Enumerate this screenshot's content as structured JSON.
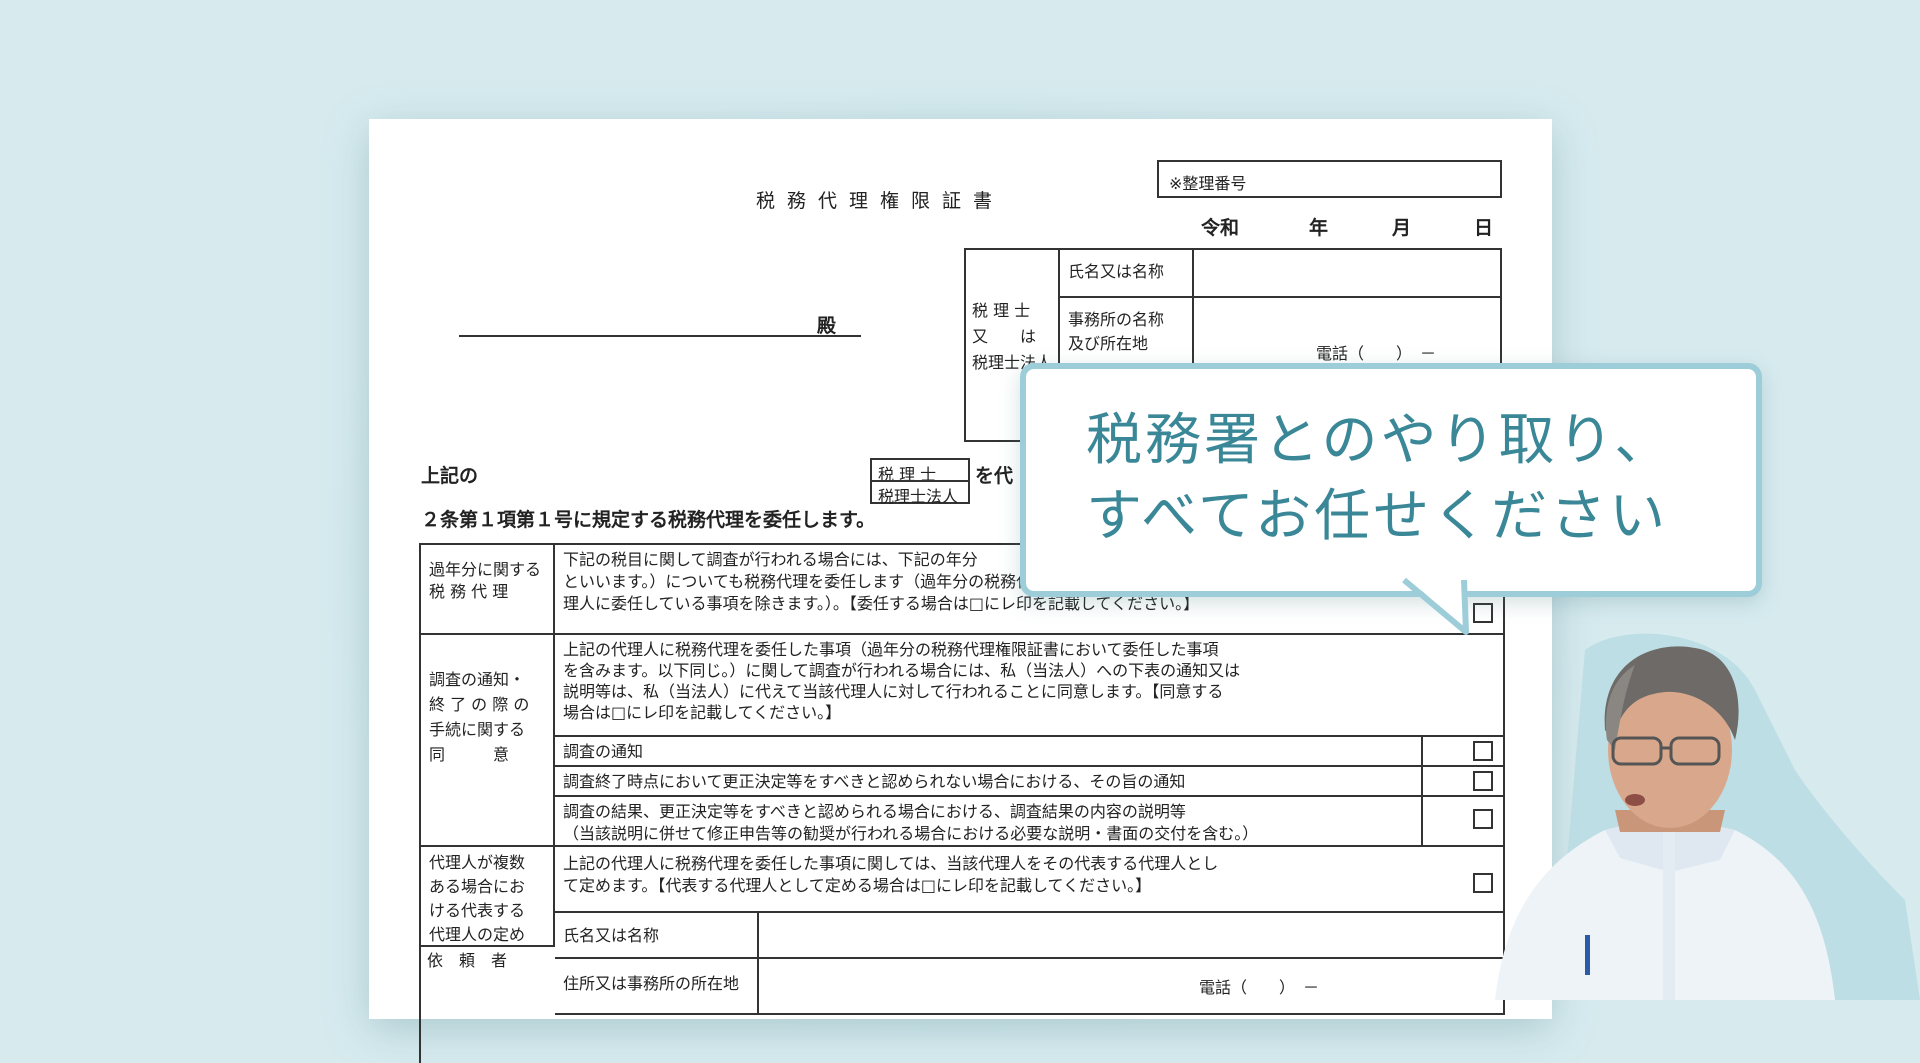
{
  "document": {
    "title": "税務代理権限証書",
    "seiri_bango": "※整理番号",
    "date": {
      "era": "令和",
      "year": "年",
      "month": "月",
      "day": "日"
    },
    "addressee_suffix": "殿",
    "agent": {
      "label_lines": [
        "税 理 士",
        "又　　は",
        "税理士法人"
      ],
      "name_label": "氏名又は名称",
      "office_label_lines": [
        "事務所の名称",
        "及び所在地"
      ],
      "phone": "電話（　　）　－"
    },
    "intro_line1_prefix": "上記の",
    "zeirishi_options": [
      "税 理 士",
      "税理士法人"
    ],
    "intro_line1_suffix": "を代",
    "intro_line2": "２条第１項第１号に規定する税務代理を委任します。",
    "rows": {
      "past_years": {
        "label_lines": [
          "過年分に関する",
          "税 務 代 理"
        ],
        "text_lines": [
          "下記の税目に関して調査が行われる場合には、下記の年分",
          "といいます。）についても税務代理を委任します（過年分の税務代理権限証書において上記の代",
          "理人に委任している事項を除きます。）。【委任する場合は□にレ印を記載してください。】"
        ]
      },
      "notification": {
        "label_lines": [
          "調査の通知・",
          "終 了 の 際 の",
          "手続に関する",
          "同　　　意"
        ],
        "text_lines": [
          "上記の代理人に税務代理を委任した事項（過年分の税務代理権限証書において委任した事項",
          "を含みます。以下同じ。）に関して調査が行われる場合には、私（当法人）への下表の通知又は",
          "説明等は、私（当法人）に代えて当該代理人に対して行われることに同意します。【同意する",
          "場合は□にレ印を記載してください。】"
        ],
        "sub_items": [
          "調査の通知",
          "調査終了時点において更正決定等をすべきと認められない場合における、その旨の通知",
          "調査の結果、更正決定等をすべきと認められる場合における、調査結果の内容の説明等",
          "（当該説明に併せて修正申告等の勧奨が行われる場合における必要な説明・書面の交付を含む。）"
        ]
      },
      "representative": {
        "label_lines": [
          "代理人が複数",
          "ある場合にお",
          "ける代表する",
          "代理人の定め"
        ],
        "text_lines": [
          "上記の代理人に税務代理を委任した事項に関しては、当該代理人をその代表する代理人とし",
          "て定めます。【代表する代理人として定める場合は□にレ印を記載してください。】"
        ]
      },
      "requester": {
        "label": "依　頼　者",
        "name_label": "氏名又は名称",
        "address_label": "住所又は事務所の所在地",
        "phone": "電話（　　）　－"
      }
    }
  },
  "bubble": {
    "line1": "税務署とのやり取り、",
    "line2": "すべてお任せください"
  },
  "colors": {
    "background": "#d7ebef",
    "bubble_border": "#9ccdd8",
    "bubble_text": "#3a8797"
  }
}
